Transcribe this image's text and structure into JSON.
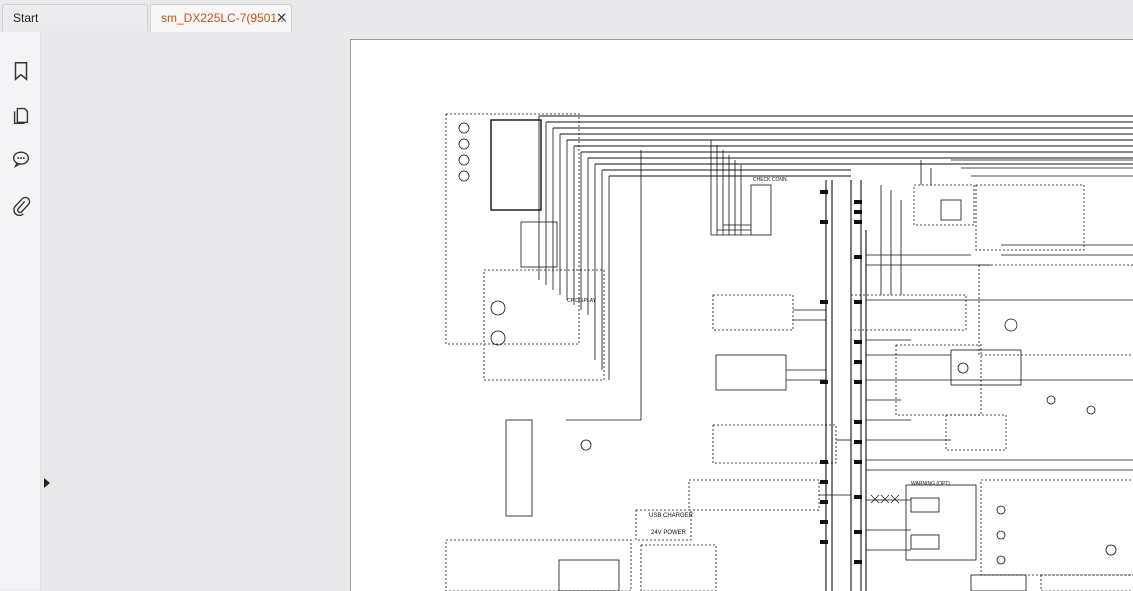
{
  "tabs": [
    {
      "label": "Start"
    },
    {
      "label": "sm_DX225LC-7(9501...",
      "close": "✕"
    }
  ],
  "sidebar": {
    "icons": [
      "bookmark-icon",
      "pages-icon",
      "comment-icon",
      "attachment-icon"
    ]
  },
  "expander": {
    "icon": "chevron-right-icon"
  },
  "schematic": {
    "labels": {
      "cp_display": "CP DISPLAY",
      "usb_charger": "USB CHARGER",
      "power_24v": "24V POWER",
      "check_conn": "CHECK CONN.",
      "warning_opt": "WARNING (OPT)"
    }
  }
}
